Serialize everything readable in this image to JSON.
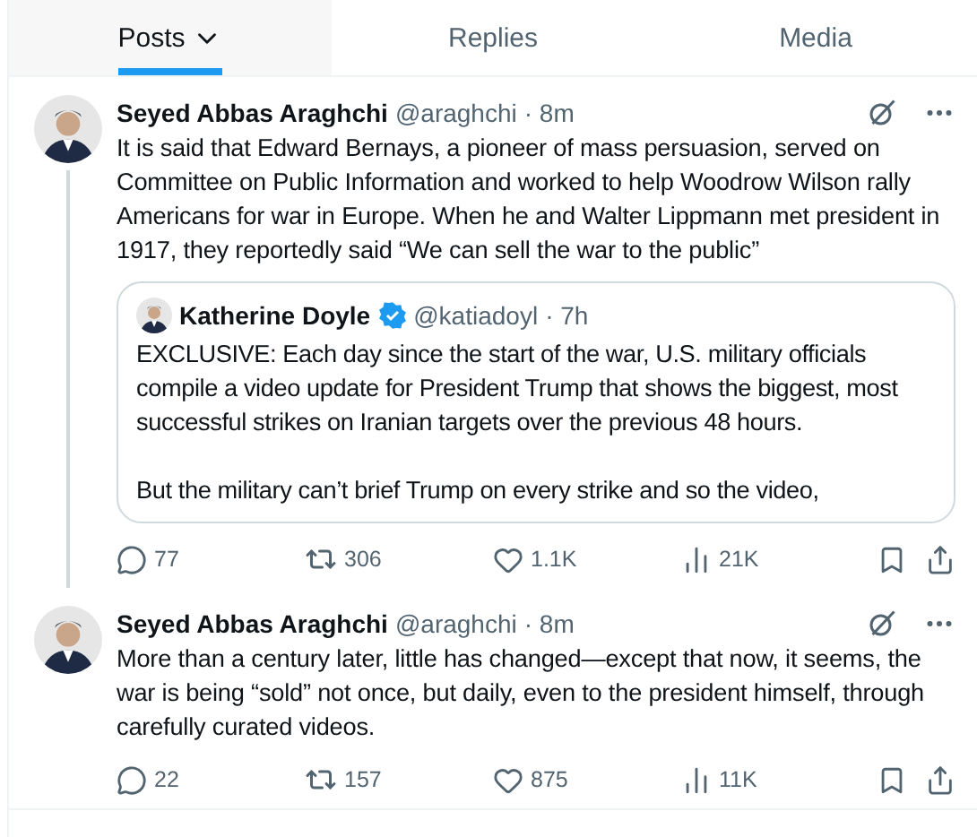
{
  "tabs": [
    {
      "label": "Posts",
      "selected": true,
      "dropdown": true
    },
    {
      "label": "Replies",
      "selected": false
    },
    {
      "label": "Media",
      "selected": false
    }
  ],
  "posts": [
    {
      "name": "Seyed Abbas Araghchi",
      "handle": "@araghchi",
      "time": "· 8m",
      "text": "It is said that Edward Bernays, a pioneer of mass persuasion, served on Committee on Public Information and worked to help Woodrow Wilson rally Americans for war in Europe. When he and Walter Lippmann met president in 1917, they reportedly said “We can sell the war to the public”",
      "thread_continues": true,
      "quote": {
        "name": "Katherine Doyle",
        "verified": true,
        "handle": "@katiadoyl",
        "time": "· 7h",
        "paragraphs": [
          "EXCLUSIVE: Each day since the start of the war, U.S. military officials compile a video update for President Trump that shows the biggest, most successful strikes on Iranian targets over the previous 48 hours.",
          "But the military can’t brief Trump on every strike and so the video,"
        ]
      },
      "replies": "77",
      "reposts": "306",
      "likes": "1.1K",
      "views": "21K"
    },
    {
      "name": "Seyed Abbas Araghchi",
      "handle": "@araghchi",
      "time": "· 8m",
      "text": "More than a century later, little has changed—except that now, it seems, the war is being “sold” not once, but daily, even to the president himself, through carefully curated videos.",
      "thread_continues": false,
      "replies": "22",
      "reposts": "157",
      "likes": "875",
      "views": "11K"
    }
  ]
}
